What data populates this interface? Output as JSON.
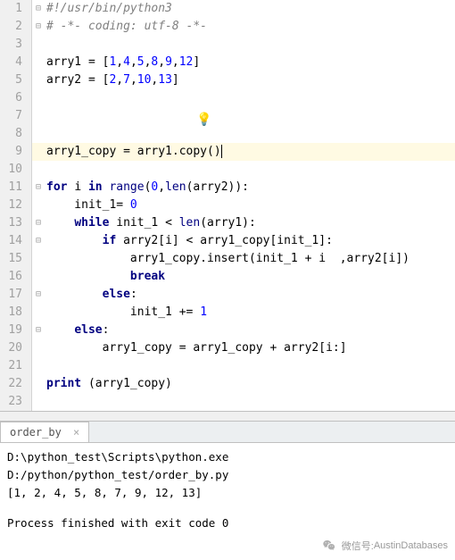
{
  "lines": [
    {
      "n": 1,
      "fold": "⊟",
      "tokens": [
        {
          "t": "#!/usr/bin/python3",
          "c": "cmt"
        }
      ]
    },
    {
      "n": 2,
      "fold": "⊟",
      "tokens": [
        {
          "t": "# -*- coding: utf-8 -*-",
          "c": "cmt"
        }
      ]
    },
    {
      "n": 3,
      "tokens": []
    },
    {
      "n": 4,
      "tokens": [
        {
          "t": "arry1 = ["
        },
        {
          "t": "1",
          "c": "num"
        },
        {
          "t": ","
        },
        {
          "t": "4",
          "c": "num"
        },
        {
          "t": ","
        },
        {
          "t": "5",
          "c": "num"
        },
        {
          "t": ","
        },
        {
          "t": "8",
          "c": "num"
        },
        {
          "t": ","
        },
        {
          "t": "9",
          "c": "num"
        },
        {
          "t": ","
        },
        {
          "t": "12",
          "c": "num"
        },
        {
          "t": "]"
        }
      ]
    },
    {
      "n": 5,
      "tokens": [
        {
          "t": "arry2 = ["
        },
        {
          "t": "2",
          "c": "num"
        },
        {
          "t": ","
        },
        {
          "t": "7",
          "c": "num"
        },
        {
          "t": ","
        },
        {
          "t": "10",
          "c": "num"
        },
        {
          "t": ","
        },
        {
          "t": "13",
          "c": "num"
        },
        {
          "t": "]"
        }
      ]
    },
    {
      "n": 6,
      "tokens": []
    },
    {
      "n": 7,
      "tokens": []
    },
    {
      "n": 8,
      "tokens": [],
      "bulb": true
    },
    {
      "n": 9,
      "hl": true,
      "tokens": [
        {
          "t": "arry1_copy = arry1.copy()"
        }
      ],
      "caret": true
    },
    {
      "n": 10,
      "tokens": []
    },
    {
      "n": 11,
      "fold": "⊟",
      "tokens": [
        {
          "t": "for ",
          "c": "kw"
        },
        {
          "t": "i "
        },
        {
          "t": "in ",
          "c": "kw"
        },
        {
          "t": "range",
          "c": "builtin"
        },
        {
          "t": "("
        },
        {
          "t": "0",
          "c": "num"
        },
        {
          "t": ","
        },
        {
          "t": "len",
          "c": "builtin"
        },
        {
          "t": "(arry2)):"
        }
      ]
    },
    {
      "n": 12,
      "tokens": [
        {
          "t": "    init_1= "
        },
        {
          "t": "0",
          "c": "num"
        }
      ]
    },
    {
      "n": 13,
      "fold": "⊟",
      "tokens": [
        {
          "t": "    "
        },
        {
          "t": "while ",
          "c": "kw"
        },
        {
          "t": "init_1 < "
        },
        {
          "t": "len",
          "c": "builtin"
        },
        {
          "t": "(arry1):"
        }
      ]
    },
    {
      "n": 14,
      "fold": "⊟",
      "tokens": [
        {
          "t": "        "
        },
        {
          "t": "if ",
          "c": "kw"
        },
        {
          "t": "arry2[i] < arry1_copy[init_1]:"
        }
      ]
    },
    {
      "n": 15,
      "tokens": [
        {
          "t": "            arry1_copy.insert(init_1 + i  ,arry2[i])"
        }
      ]
    },
    {
      "n": 16,
      "tokens": [
        {
          "t": "            "
        },
        {
          "t": "break",
          "c": "kw"
        }
      ]
    },
    {
      "n": 17,
      "fold": "⊟",
      "tokens": [
        {
          "t": "        "
        },
        {
          "t": "else",
          "c": "kw"
        },
        {
          "t": ":"
        }
      ]
    },
    {
      "n": 18,
      "tokens": [
        {
          "t": "            init_1 += "
        },
        {
          "t": "1",
          "c": "num"
        }
      ]
    },
    {
      "n": 19,
      "fold": "⊟",
      "tokens": [
        {
          "t": "    "
        },
        {
          "t": "else",
          "c": "kw"
        },
        {
          "t": ":"
        }
      ]
    },
    {
      "n": 20,
      "tokens": [
        {
          "t": "        arry1_copy = arry1_copy + arry2[i:]"
        }
      ]
    },
    {
      "n": 21,
      "tokens": []
    },
    {
      "n": 22,
      "tokens": [
        {
          "t": "print ",
          "c": "kw"
        },
        {
          "t": "(arry1_copy)"
        }
      ]
    },
    {
      "n": 23,
      "tokens": []
    }
  ],
  "tab": {
    "name": "order_by",
    "close": "×"
  },
  "console": {
    "cmd": "D:\\python_test\\Scripts\\python.exe D:/python/python_test/order_by.py",
    "output": "[1, 2, 4, 5, 8, 7, 9, 12, 13]",
    "exit": "Process finished with exit code 0"
  },
  "watermark": {
    "label": "微信号:",
    "name": "AustinDatabases"
  }
}
